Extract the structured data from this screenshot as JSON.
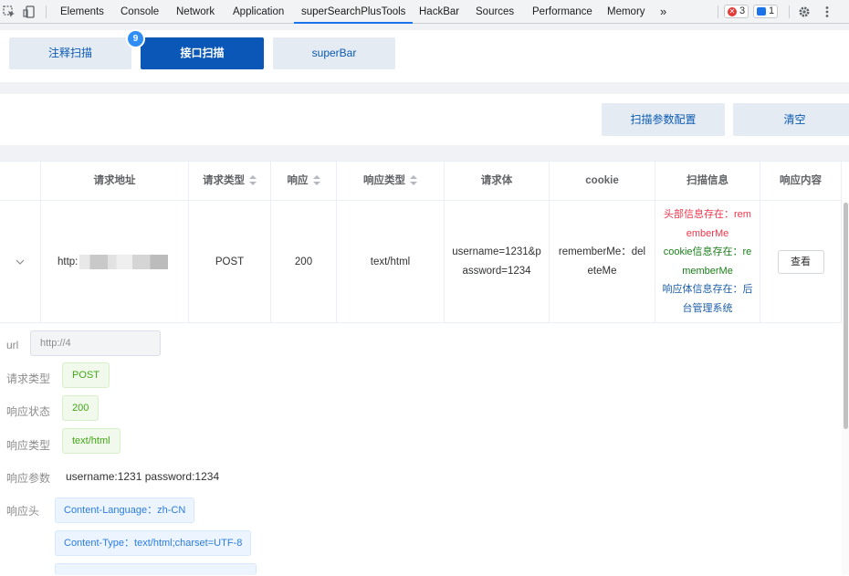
{
  "devtools": {
    "tabs": [
      "Elements",
      "Console",
      "Network",
      "Application",
      "superSearchPlusTools",
      "HackBar",
      "Sources",
      "Performance",
      "Memory"
    ],
    "more": "»",
    "errors": "3",
    "messages": "1"
  },
  "tabs": {
    "comment_scan": "注释扫描",
    "api_scan": "接口扫描",
    "superbar": "superBar",
    "badge_count": "9"
  },
  "actions": {
    "config": "扫描参数配置",
    "clear": "清空"
  },
  "table": {
    "headers": [
      "请求地址",
      "请求类型",
      "响应",
      "响应类型",
      "请求体",
      "cookie",
      "扫描信息",
      "响应内容"
    ],
    "row": {
      "url": "http:",
      "method": "POST",
      "status": "200",
      "content_type": "text/html",
      "body": "username=1231&password=1234",
      "cookie": "rememberMe：deleteMe",
      "scan_header": "头部信息存在：rememberMe",
      "scan_cookie": "cookie信息存在：rememberMe",
      "scan_body": "响应体信息存在：后台管理系统",
      "view_button": "查看"
    }
  },
  "details": {
    "url_label": "url",
    "url_value": "http://4",
    "method_label": "请求类型",
    "method_value": "POST",
    "status_label": "响应状态",
    "status_value": "200",
    "type_label": "响应类型",
    "type_value": "text/html",
    "params_label": "响应参数",
    "params_value": "username:1231 password:1234",
    "headers_label": "响应头",
    "headers": [
      "Content-Language：zh-CN",
      "Content-Type：text/html;charset=UTF-8"
    ]
  },
  "colors": {
    "primary": "#0a57b7",
    "tab_light": "#e4ebf3",
    "red": "#f0364d",
    "green": "#1a7f1a",
    "blue": "#1d5ea9"
  }
}
